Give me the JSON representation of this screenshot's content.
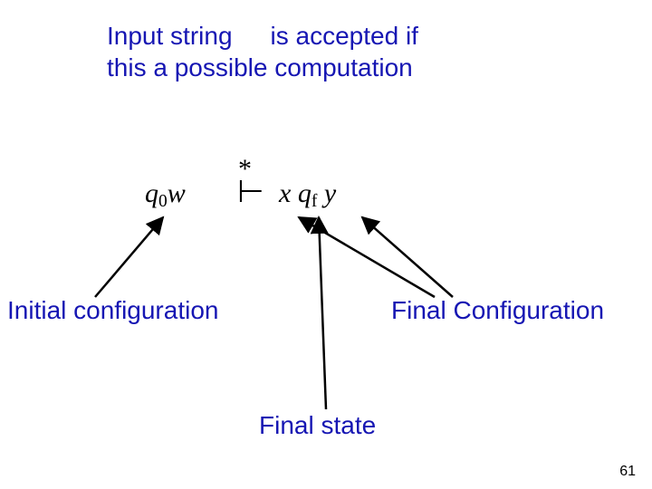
{
  "heading": {
    "part1": "Input string",
    "part2": "is accepted if",
    "line2": "this a possible computation"
  },
  "formula": {
    "left_q": "q",
    "left_sub": "0",
    "left_w": "w",
    "star": "*",
    "rel_symbol": "⊢",
    "right_x": "x",
    "right_q": "q",
    "right_sub": "f",
    "right_y": "y"
  },
  "labels": {
    "initial": "Initial configuration",
    "final": "Final Configuration",
    "final_state": "Final state"
  },
  "page_number": "61"
}
